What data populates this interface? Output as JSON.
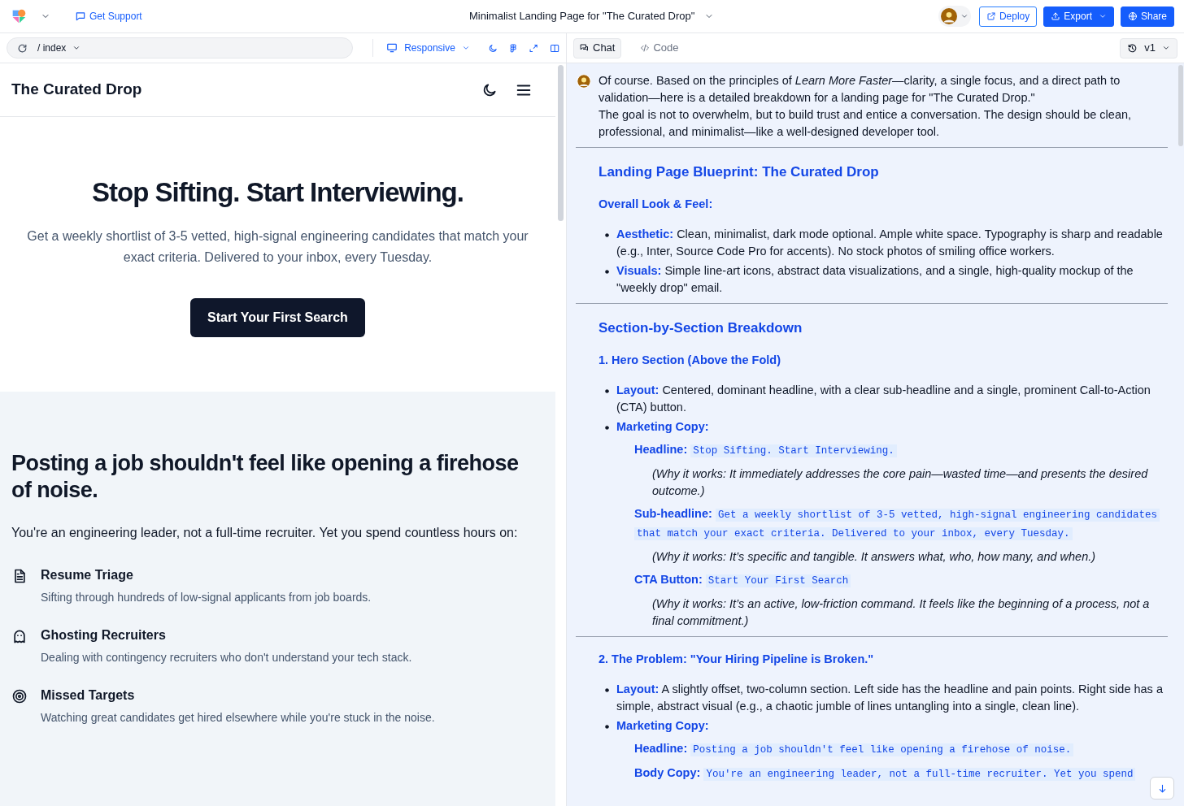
{
  "topbar": {
    "support": "Get Support",
    "title": "Minimalist Landing Page for \"The Curated Drop\"",
    "buttons": [
      {
        "label": "Deploy",
        "kind": "outline",
        "dropdown": false
      },
      {
        "label": "Export",
        "kind": "solid",
        "dropdown": true
      },
      {
        "label": "Share",
        "kind": "solid",
        "dropdown": false
      }
    ]
  },
  "preview_toolbar": {
    "path": "/ index",
    "viewport": "Responsive"
  },
  "chat_tabs": [
    {
      "label": "Chat",
      "kind": "chat",
      "selected": true
    },
    {
      "label": "Code",
      "kind": "code",
      "selected": false
    }
  ],
  "version": "v1",
  "preview": {
    "brand": "The Curated Drop",
    "hero": {
      "headline": "Stop Sifting. Start Interviewing.",
      "subheadline": "Get a weekly shortlist of 3-5 vetted, high-signal engineering candidates that match your exact criteria. Delivered to your inbox, every Tuesday.",
      "cta": "Start Your First Search"
    },
    "problem": {
      "headline": "Posting a job shouldn't feel like opening a firehose of noise.",
      "intro": "You're an engineering leader, not a full-time recruiter. Yet you spend countless hours on:",
      "items": [
        {
          "title": "Resume Triage",
          "text": "Sifting through hundreds of low-signal applicants from job boards."
        },
        {
          "title": "Ghosting Recruiters",
          "text": "Dealing with contingency recruiters who don't understand your tech stack."
        },
        {
          "title": "Missed Targets",
          "text": "Watching great candidates get hired elsewhere while you're stuck in the noise."
        }
      ]
    }
  },
  "chat": [
    {
      "kind": "paragraph",
      "text": "Of course. Based on the principles of *Learn More Faster*—clarity, a single focus, and a direct path to validation—here is a detailed breakdown for a landing page for \"The Curated Drop.\""
    },
    {
      "kind": "paragraph",
      "text": "The goal is not to overwhelm, but to build trust and entice a conversation. The design should be clean, professional, and minimalist—like a well-designed developer tool."
    },
    {
      "kind": "rule"
    },
    {
      "kind": "h2",
      "text": "Landing Page Blueprint: The Curated Drop"
    },
    {
      "kind": "h3",
      "text": "Overall Look & Feel:"
    },
    {
      "kind": "bullet",
      "label": "Aesthetic:",
      "text": "Clean, minimalist, dark mode optional. Ample white space. Typography is sharp and readable (e.g., Inter, Source Code Pro for accents). No stock photos of smiling office workers."
    },
    {
      "kind": "bullet",
      "label": "Visuals:",
      "text": "Simple line-art icons, abstract data visualizations, and a single, high-quality mockup of the \"weekly drop\" email."
    },
    {
      "kind": "rule"
    },
    {
      "kind": "h2",
      "text": "Section-by-Section Breakdown"
    },
    {
      "kind": "h3",
      "text": "1. Hero Section (Above the Fold)"
    },
    {
      "kind": "bullet",
      "label": "Layout:",
      "text": "Centered, dominant headline, with a clear sub-headline and a single, prominent Call-to-Action (CTA) button."
    },
    {
      "kind": "bullet",
      "label": "Marketing Copy:"
    },
    {
      "kind": "copy",
      "label": "Headline:",
      "code": "Stop Sifting. Start Interviewing."
    },
    {
      "kind": "why",
      "text": "(Why it works: It immediately addresses the core pain—wasted time—and presents the desired outcome.)"
    },
    {
      "kind": "copy",
      "label": "Sub-headline:",
      "code": "Get a weekly shortlist of 3-5 vetted, high-signal engineering candidates that match your exact criteria. Delivered to your inbox, every Tuesday."
    },
    {
      "kind": "why",
      "text": "(Why it works: It’s specific and tangible. It answers what, who, how many, and when.)"
    },
    {
      "kind": "copy",
      "label": "CTA Button:",
      "code": "Start Your First Search"
    },
    {
      "kind": "why",
      "text": "(Why it works: It’s an active, low-friction command. It feels like the beginning of a process, not a final commitment.)"
    },
    {
      "kind": "rule"
    },
    {
      "kind": "h3",
      "text": "2. The Problem: \"Your Hiring Pipeline is Broken.\""
    },
    {
      "kind": "bullet",
      "label": "Layout:",
      "text": "A slightly offset, two-column section. Left side has the headline and pain points. Right side has a simple, abstract visual (e.g., a chaotic jumble of lines untangling into a single, clean line)."
    },
    {
      "kind": "bullet",
      "label": "Marketing Copy:"
    },
    {
      "kind": "copy",
      "label": "Headline:",
      "code": "Posting a job shouldn't feel like opening a firehose of noise."
    },
    {
      "kind": "copy",
      "label": "Body Copy:",
      "code": "You're an engineering leader, not a full-time recruiter. Yet you spend"
    }
  ]
}
